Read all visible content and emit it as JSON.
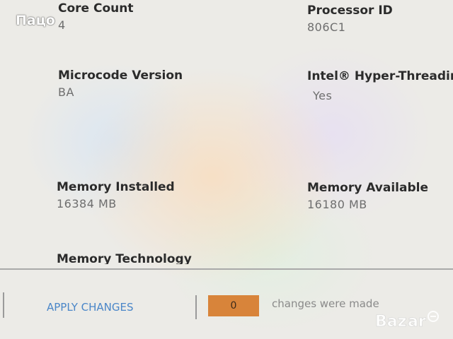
{
  "fields": {
    "core_count": {
      "label": "Core Count",
      "value": "4"
    },
    "processor_id": {
      "label": "Processor ID",
      "value": "806C1"
    },
    "microcode_version": {
      "label": "Microcode Version",
      "value": "BA"
    },
    "hyper_threading": {
      "label": "Intel® Hyper-Threadin",
      "value": "Yes"
    },
    "memory_installed": {
      "label": "Memory Installed",
      "value": "16384 MB"
    },
    "memory_available": {
      "label": "Memory Available",
      "value": "16180 MB"
    },
    "memory_technology": {
      "label": "Memory Technology"
    }
  },
  "footer": {
    "apply_label": "APPLY CHANGES",
    "changes_count": "0",
    "changes_text": "changes were made"
  },
  "watermark": {
    "text": "Пацо",
    "logo_text": "Bazar"
  },
  "colors": {
    "accent_link": "#4a86c8",
    "count_box": "#d8843a"
  }
}
